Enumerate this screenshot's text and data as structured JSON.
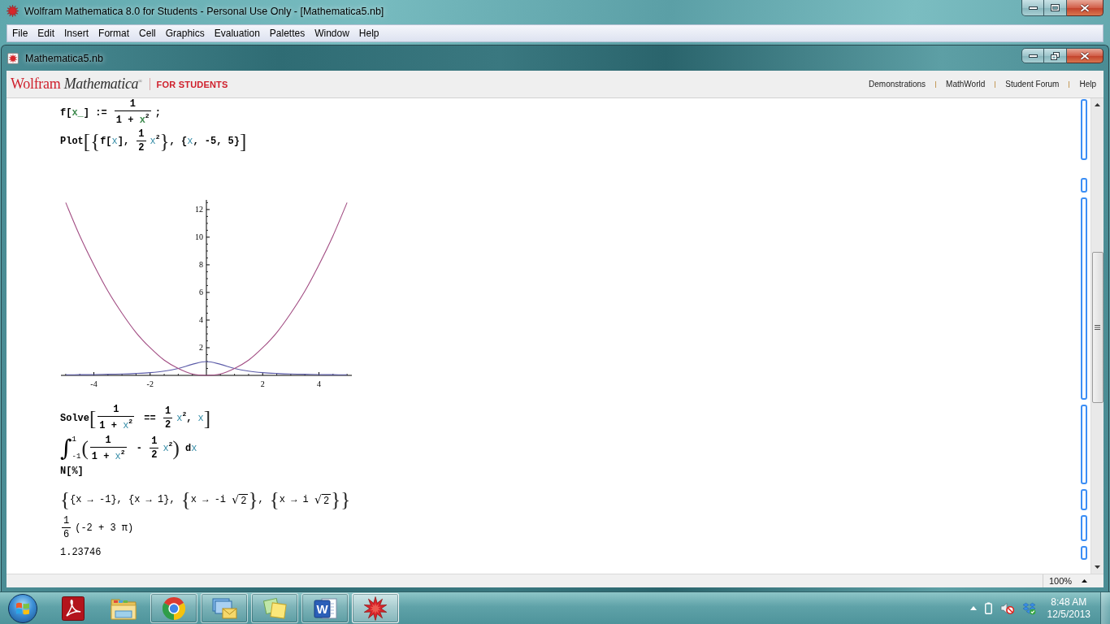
{
  "window": {
    "title": "Wolfram Mathematica 8.0 for Students - Personal Use Only - [Mathematica5.nb]"
  },
  "menu": [
    "File",
    "Edit",
    "Insert",
    "Format",
    "Cell",
    "Graphics",
    "Evaluation",
    "Palettes",
    "Window",
    "Help"
  ],
  "document_window": {
    "title": "Mathematica5.nb"
  },
  "banner": {
    "logo": "Wolfram *Mathematica*$^{®}$",
    "edition": "FOR STUDENTS",
    "links": [
      "Demonstrations",
      "MathWorld",
      "Student Forum",
      "Help"
    ]
  },
  "notebook": {
    "cells": [
      {
        "kind": "input",
        "lines": [
          [
            {
              "kind": "code",
              "text": "f["
            },
            {
              "kind": "pattern",
              "text": "x_"
            },
            {
              "kind": "code",
              "text": "] := "
            },
            {
              "kind": "fraction",
              "num": [
                {
                  "kind": "code",
                  "text": "1"
                }
              ],
              "den": [
                {
                  "kind": "code",
                  "text": "1 + "
                },
                {
                  "kind": "pattern",
                  "text": "x"
                },
                {
                  "kind": "superscript",
                  "text": "2"
                }
              ]
            },
            {
              "kind": "code",
              "text": ";"
            }
          ],
          [
            {
              "kind": "code",
              "text": "Plot"
            },
            {
              "kind": "bracket",
              "text": "["
            },
            {
              "kind": "bracket",
              "text": "{"
            },
            {
              "kind": "code",
              "text": "f["
            },
            {
              "kind": "variable",
              "text": "x"
            },
            {
              "kind": "code",
              "text": "], "
            },
            {
              "kind": "fraction",
              "num": [
                {
                  "kind": "code",
                  "text": "1"
                }
              ],
              "den": [
                {
                  "kind": "code",
                  "text": "2"
                }
              ]
            },
            {
              "kind": "variable",
              "text": "x"
            },
            {
              "kind": "superscript",
              "text": "2"
            },
            {
              "kind": "bracket",
              "text": "}"
            },
            {
              "kind": "code",
              "text": ", {"
            },
            {
              "kind": "variable",
              "text": "x"
            },
            {
              "kind": "code",
              "text": ", -5, 5}"
            },
            {
              "kind": "bracket",
              "text": "]"
            }
          ]
        ]
      },
      {
        "kind": "empty"
      },
      {
        "kind": "graphics",
        "chart_data": {
          "type": "line",
          "x": [
            -5,
            -4.5,
            -4,
            -3.5,
            -3,
            -2.5,
            -2,
            -1.5,
            -1,
            -0.5,
            0,
            0.5,
            1,
            1.5,
            2,
            2.5,
            3,
            3.5,
            4,
            4.5,
            5
          ],
          "series": [
            {
              "color": "#5b5ba8",
              "values": [
                0.04,
                0.05,
                0.06,
                0.08,
                0.1,
                0.14,
                0.2,
                0.31,
                0.5,
                0.8,
                1,
                0.8,
                0.5,
                0.31,
                0.2,
                0.14,
                0.1,
                0.08,
                0.06,
                0.05,
                0.04
              ]
            },
            {
              "color": "#a24d83",
              "values": [
                12.5,
                10.1,
                8,
                6.1,
                4.5,
                3.1,
                2,
                1.1,
                0.5,
                0.1,
                0,
                0.1,
                0.5,
                1.1,
                2,
                3.1,
                4.5,
                6.1,
                8,
                10.1,
                12.5
              ]
            }
          ],
          "xlim": [
            -5.17,
            5.17
          ],
          "ylim": [
            0,
            12.7
          ],
          "xticks": [
            -4,
            -2,
            2,
            4
          ],
          "yticks": [
            2,
            4,
            6,
            8,
            10,
            12
          ]
        }
      },
      {
        "kind": "input",
        "lines": [
          [
            {
              "kind": "code",
              "text": "Solve"
            },
            {
              "kind": "bracket",
              "text": "["
            },
            {
              "kind": "fraction",
              "num": [
                {
                  "kind": "code",
                  "text": "1"
                }
              ],
              "den": [
                {
                  "kind": "code",
                  "text": "1 + "
                },
                {
                  "kind": "variable",
                  "text": "x"
                },
                {
                  "kind": "superscript",
                  "text": "2"
                }
              ]
            },
            {
              "kind": "code",
              "text": " == "
            },
            {
              "kind": "fraction",
              "num": [
                {
                  "kind": "code",
                  "text": "1"
                }
              ],
              "den": [
                {
                  "kind": "code",
                  "text": "2"
                }
              ]
            },
            {
              "kind": "variable",
              "text": "x"
            },
            {
              "kind": "superscript",
              "text": "2"
            },
            {
              "kind": "code",
              "text": ", "
            },
            {
              "kind": "variable",
              "text": "x"
            },
            {
              "kind": "bracket",
              "text": "]"
            }
          ],
          [
            {
              "kind": "integral",
              "sign": "∫",
              "lower": "-1",
              "upper": "1"
            },
            {
              "kind": "bracket",
              "text": "("
            },
            {
              "kind": "fraction",
              "num": [
                {
                  "kind": "code",
                  "text": "1"
                }
              ],
              "den": [
                {
                  "kind": "code",
                  "text": "1 + "
                },
                {
                  "kind": "variable",
                  "text": "x"
                },
                {
                  "kind": "superscript",
                  "text": "2"
                }
              ]
            },
            {
              "kind": "code",
              "text": " - "
            },
            {
              "kind": "fraction",
              "num": [
                {
                  "kind": "code",
                  "text": "1"
                }
              ],
              "den": [
                {
                  "kind": "code",
                  "text": "2"
                }
              ]
            },
            {
              "kind": "variable",
              "text": "x"
            },
            {
              "kind": "superscript",
              "text": "2"
            },
            {
              "kind": "bracket",
              "text": ")"
            },
            {
              "kind": "code",
              "text": " d"
            },
            {
              "kind": "variable",
              "text": "x"
            }
          ],
          [
            {
              "kind": "code",
              "text": "N[%]"
            }
          ]
        ]
      },
      {
        "kind": "output",
        "lines": [
          [
            {
              "kind": "bracket",
              "text": "{"
            },
            {
              "kind": "code",
              "text": "{x → -1}, {x → 1}, "
            },
            {
              "kind": "bracket",
              "text": "{"
            },
            {
              "kind": "code",
              "text": "x → -i "
            },
            {
              "kind": "sqrt",
              "sign": "√",
              "text": "2"
            },
            {
              "kind": "bracket",
              "text": "}"
            },
            {
              "kind": "code",
              "text": ", "
            },
            {
              "kind": "bracket",
              "text": "{"
            },
            {
              "kind": "code",
              "text": "x → i "
            },
            {
              "kind": "sqrt",
              "sign": "√",
              "text": "2"
            },
            {
              "kind": "bracket",
              "text": "}"
            },
            {
              "kind": "bracket",
              "text": "}"
            }
          ]
        ]
      },
      {
        "kind": "output",
        "lines": [
          [
            {
              "kind": "fraction",
              "num": [
                {
                  "kind": "code",
                  "text": "1"
                }
              ],
              "den": [
                {
                  "kind": "code",
                  "text": "6"
                }
              ]
            },
            {
              "kind": "code",
              "text": "(-2 + 3 π)"
            }
          ]
        ]
      },
      {
        "kind": "output",
        "lines": [
          [
            {
              "kind": "code",
              "text": "1.23746"
            }
          ]
        ]
      }
    ]
  },
  "status_bar": {
    "zoom": "100%"
  },
  "taskbar": {
    "apps": [
      {
        "kind": "pdf",
        "open": false,
        "selected": false
      },
      {
        "kind": "folder",
        "open": false,
        "selected": false
      },
      {
        "kind": "browser",
        "open": true,
        "selected": false
      },
      {
        "kind": "mail",
        "open": true,
        "selected": false
      },
      {
        "kind": "notes",
        "open": true,
        "selected": false
      },
      {
        "kind": "word",
        "letter": "W",
        "open": true,
        "selected": false
      },
      {
        "kind": "mathematica",
        "open": true,
        "selected": true
      }
    ],
    "clock": {
      "time": "8:48 AM",
      "date": "12/5/2013"
    }
  }
}
